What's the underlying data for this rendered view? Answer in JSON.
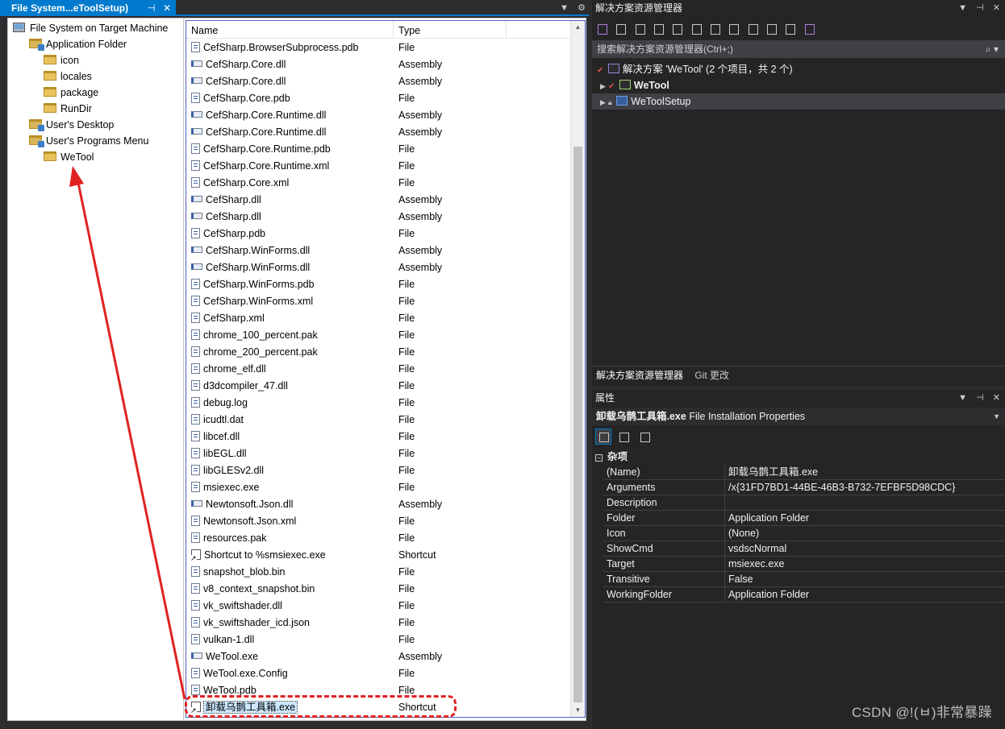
{
  "document_tab": {
    "title": "File System...eToolSetup)",
    "pin": "⊣",
    "close": "✕"
  },
  "tree": {
    "root": "File System on Target Machine",
    "nodes": [
      {
        "label": "Application Folder",
        "level": 1,
        "icon": "special-folder-icon"
      },
      {
        "label": "icon",
        "level": 2,
        "icon": "folder-icon"
      },
      {
        "label": "locales",
        "level": 2,
        "icon": "folder-icon"
      },
      {
        "label": "package",
        "level": 2,
        "icon": "folder-icon"
      },
      {
        "label": "RunDir",
        "level": 2,
        "icon": "folder-icon"
      },
      {
        "label": "User's Desktop",
        "level": 1,
        "icon": "special-folder-icon"
      },
      {
        "label": "User's Programs Menu",
        "level": 1,
        "icon": "special-folder-icon"
      },
      {
        "label": "WeTool",
        "level": 2,
        "icon": "folder-icon"
      }
    ]
  },
  "list": {
    "col_name": "Name",
    "col_type": "Type",
    "rows": [
      {
        "name": "CefSharp.BrowserSubprocess.pdb",
        "type": "File",
        "icon": "file"
      },
      {
        "name": "CefSharp.Core.dll",
        "type": "Assembly",
        "icon": "asm"
      },
      {
        "name": "CefSharp.Core.dll",
        "type": "Assembly",
        "icon": "asm"
      },
      {
        "name": "CefSharp.Core.pdb",
        "type": "File",
        "icon": "file"
      },
      {
        "name": "CefSharp.Core.Runtime.dll",
        "type": "Assembly",
        "icon": "asm"
      },
      {
        "name": "CefSharp.Core.Runtime.dll",
        "type": "Assembly",
        "icon": "asm"
      },
      {
        "name": "CefSharp.Core.Runtime.pdb",
        "type": "File",
        "icon": "file"
      },
      {
        "name": "CefSharp.Core.Runtime.xml",
        "type": "File",
        "icon": "file"
      },
      {
        "name": "CefSharp.Core.xml",
        "type": "File",
        "icon": "file"
      },
      {
        "name": "CefSharp.dll",
        "type": "Assembly",
        "icon": "asm"
      },
      {
        "name": "CefSharp.dll",
        "type": "Assembly",
        "icon": "asm"
      },
      {
        "name": "CefSharp.pdb",
        "type": "File",
        "icon": "file"
      },
      {
        "name": "CefSharp.WinForms.dll",
        "type": "Assembly",
        "icon": "asm"
      },
      {
        "name": "CefSharp.WinForms.dll",
        "type": "Assembly",
        "icon": "asm"
      },
      {
        "name": "CefSharp.WinForms.pdb",
        "type": "File",
        "icon": "file"
      },
      {
        "name": "CefSharp.WinForms.xml",
        "type": "File",
        "icon": "file"
      },
      {
        "name": "CefSharp.xml",
        "type": "File",
        "icon": "file"
      },
      {
        "name": "chrome_100_percent.pak",
        "type": "File",
        "icon": "file"
      },
      {
        "name": "chrome_200_percent.pak",
        "type": "File",
        "icon": "file"
      },
      {
        "name": "chrome_elf.dll",
        "type": "File",
        "icon": "file"
      },
      {
        "name": "d3dcompiler_47.dll",
        "type": "File",
        "icon": "file"
      },
      {
        "name": "debug.log",
        "type": "File",
        "icon": "file"
      },
      {
        "name": "icudtl.dat",
        "type": "File",
        "icon": "file"
      },
      {
        "name": "libcef.dll",
        "type": "File",
        "icon": "file"
      },
      {
        "name": "libEGL.dll",
        "type": "File",
        "icon": "file"
      },
      {
        "name": "libGLESv2.dll",
        "type": "File",
        "icon": "file"
      },
      {
        "name": "msiexec.exe",
        "type": "File",
        "icon": "file"
      },
      {
        "name": "Newtonsoft.Json.dll",
        "type": "Assembly",
        "icon": "asm"
      },
      {
        "name": "Newtonsoft.Json.xml",
        "type": "File",
        "icon": "file"
      },
      {
        "name": "resources.pak",
        "type": "File",
        "icon": "file"
      },
      {
        "name": "Shortcut to %smsiexec.exe",
        "type": "Shortcut",
        "icon": "sc"
      },
      {
        "name": "snapshot_blob.bin",
        "type": "File",
        "icon": "file"
      },
      {
        "name": "v8_context_snapshot.bin",
        "type": "File",
        "icon": "file"
      },
      {
        "name": "vk_swiftshader.dll",
        "type": "File",
        "icon": "file"
      },
      {
        "name": "vk_swiftshader_icd.json",
        "type": "File",
        "icon": "file"
      },
      {
        "name": "vulkan-1.dll",
        "type": "File",
        "icon": "file"
      },
      {
        "name": "WeTool.exe",
        "type": "Assembly",
        "icon": "asm"
      },
      {
        "name": "WeTool.exe.Config",
        "type": "File",
        "icon": "file"
      },
      {
        "name": "WeTool.pdb",
        "type": "File",
        "icon": "file"
      },
      {
        "name": "卸载乌鹊工具箱.exe",
        "type": "Shortcut",
        "icon": "sc",
        "selected": true
      }
    ]
  },
  "solution_explorer": {
    "title": "解决方案资源管理器",
    "search_placeholder": "搜索解决方案资源管理器(Ctrl+;)",
    "solution_label": "解决方案 'WeTool' (2 个项目，共 2 个)",
    "projects": [
      {
        "name": "WeTool",
        "bold": true
      },
      {
        "name": "WeToolSetup",
        "bold": false
      }
    ],
    "tab_active": "解决方案资源管理器",
    "tab_inactive": "Git 更改"
  },
  "properties": {
    "title": "属性",
    "object_name": "卸载乌鹊工具箱.exe",
    "object_type": "File Installation Properties",
    "category": "杂项",
    "rows": [
      {
        "key": "(Name)",
        "value": "卸载乌鹊工具箱.exe"
      },
      {
        "key": "Arguments",
        "value": "/x{31FD7BD1-44BE-46B3-B732-7EFBF5D98CDC}"
      },
      {
        "key": "Description",
        "value": ""
      },
      {
        "key": "Folder",
        "value": "Application Folder"
      },
      {
        "key": "Icon",
        "value": "(None)"
      },
      {
        "key": "ShowCmd",
        "value": "vsdscNormal"
      },
      {
        "key": "Target",
        "value": "msiexec.exe"
      },
      {
        "key": "Transitive",
        "value": "False"
      },
      {
        "key": "WorkingFolder",
        "value": "Application Folder"
      }
    ]
  },
  "watermark": "CSDN @︎︎︎!(︎︎︎ㅂ︎︎)︎非常暴躁",
  "colors": {
    "accent": "#007acc",
    "annotation_red": "#e12121",
    "selection": "#cce8ff"
  }
}
